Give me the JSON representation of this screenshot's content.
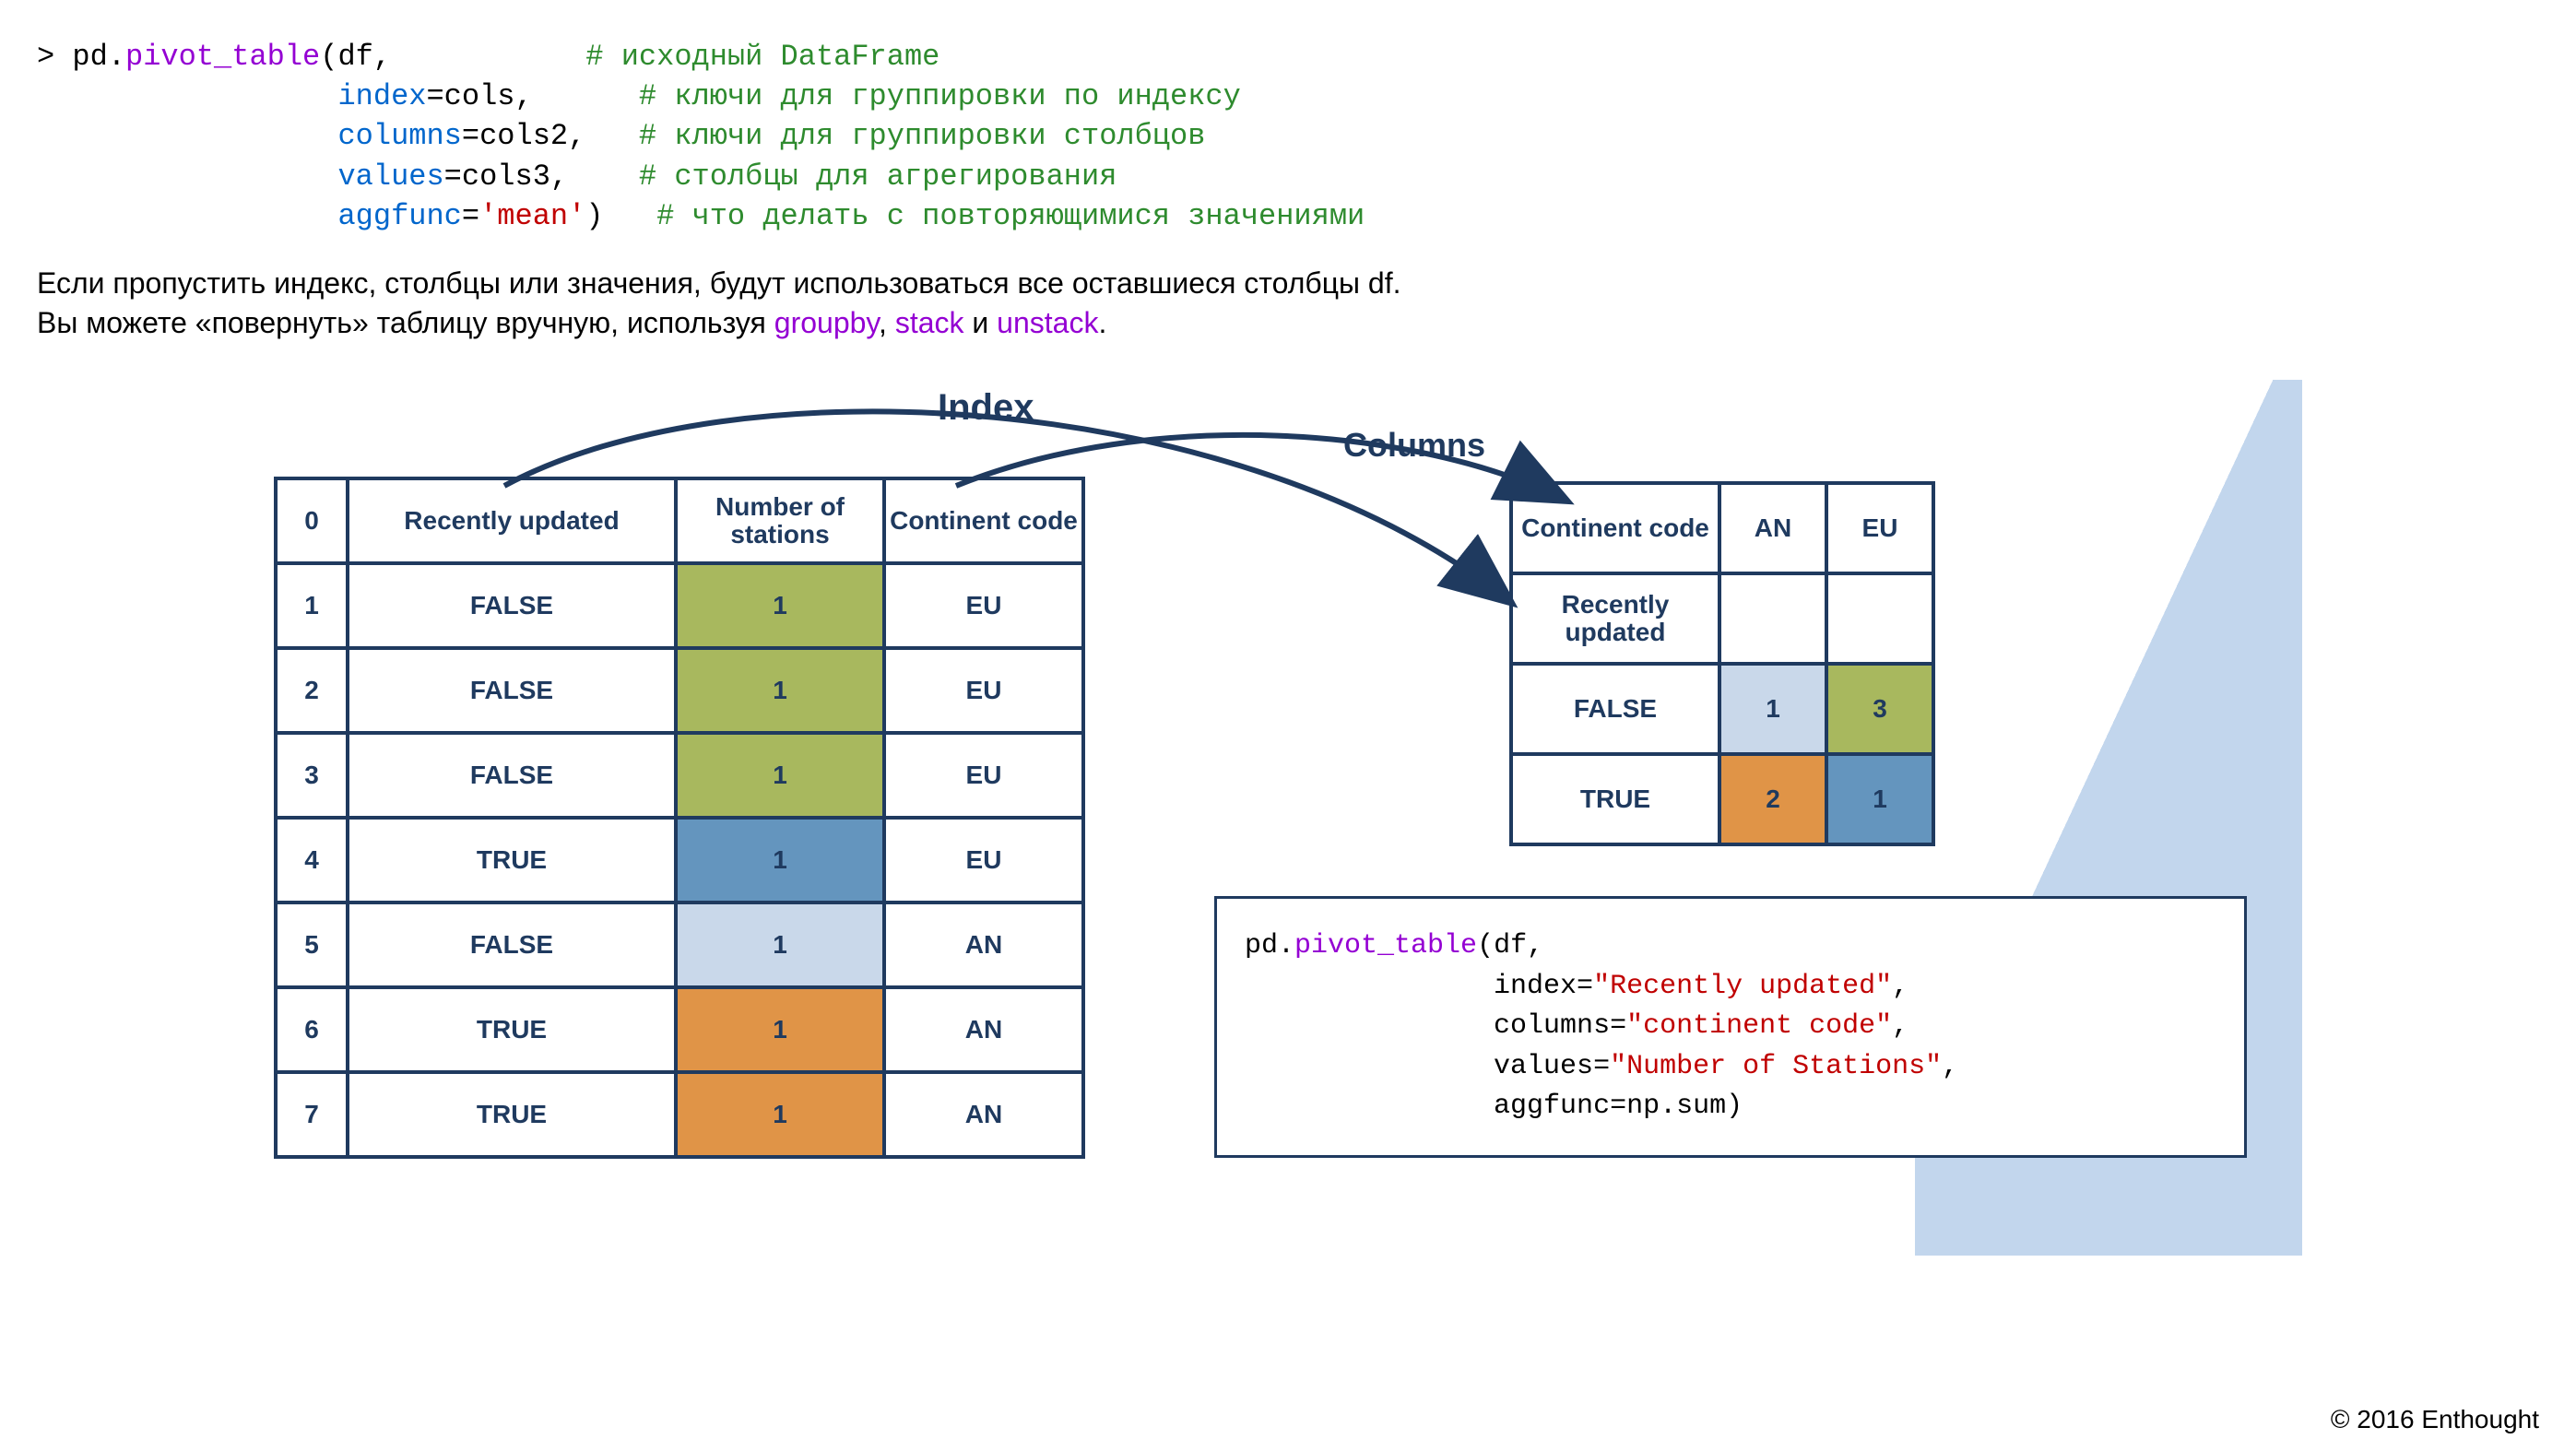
{
  "code_top": {
    "prompt": "> ",
    "call_prefix": "pd.",
    "call_func": "pivot_table",
    "arg_open": "(df,",
    "indent": "                 ",
    "kw_index": "index",
    "eq_index": "=cols,",
    "kw_columns": "columns",
    "eq_columns": "=cols2,",
    "kw_values": "values",
    "eq_values": "=cols3,",
    "kw_aggfunc": "aggfunc",
    "eq_aggfunc": "=",
    "str_mean": "'mean'",
    "close_paren": ")",
    "cmt1": "# исходный DataFrame",
    "cmt2": "# ключи для группировки по индексу",
    "cmt3": "# ключи для группировки столбцов",
    "cmt4": "# столбцы для агрегирования",
    "cmt5": "# что делать с повторяющимися значениями"
  },
  "paragraph": {
    "line1": "Если пропустить индекс, столбцы или значения, будут использоваться все оставшиеся столбцы df.",
    "line2a": "Вы можете «повернуть» таблицу вручную, используя ",
    "link1": "groupby",
    "sep1": ", ",
    "link2": "stack",
    "sep2": " и ",
    "link3": "unstack",
    "dot": "."
  },
  "labels": {
    "index": "Index",
    "columns": "Columns"
  },
  "source_table": {
    "headers": [
      "0",
      "Recently updated",
      "Number of stations",
      "Continent code"
    ],
    "rows": [
      {
        "n": "1",
        "ru": "FALSE",
        "ns": "1",
        "cc": "EU",
        "ns_class": "c-olive"
      },
      {
        "n": "2",
        "ru": "FALSE",
        "ns": "1",
        "cc": "EU",
        "ns_class": "c-olive"
      },
      {
        "n": "3",
        "ru": "FALSE",
        "ns": "1",
        "cc": "EU",
        "ns_class": "c-olive"
      },
      {
        "n": "4",
        "ru": "TRUE",
        "ns": "1",
        "cc": "EU",
        "ns_class": "c-blue-d"
      },
      {
        "n": "5",
        "ru": "FALSE",
        "ns": "1",
        "cc": "AN",
        "ns_class": "c-blue-l"
      },
      {
        "n": "6",
        "ru": "TRUE",
        "ns": "1",
        "cc": "AN",
        "ns_class": "c-orange"
      },
      {
        "n": "7",
        "ru": "TRUE",
        "ns": "1",
        "cc": "AN",
        "ns_class": "c-orange"
      }
    ]
  },
  "result_table": {
    "top_left": "Continent code",
    "col_headers": [
      "AN",
      "EU"
    ],
    "row_header_label": "Recently updated",
    "rows": [
      {
        "label": "FALSE",
        "an": "1",
        "eu": "3",
        "an_class": "c-blue-l",
        "eu_class": "c-olive"
      },
      {
        "label": "TRUE",
        "an": "2",
        "eu": "1",
        "an_class": "c-orange",
        "eu_class": "c-blue-d"
      }
    ]
  },
  "code_box": {
    "l1a": "pd.",
    "l1b": "pivot_table",
    "l1c": "(df,",
    "indent": "               ",
    "l2a": "index=",
    "l2b": "\"Recently updated\"",
    "l2c": ",",
    "l3a": "columns=",
    "l3b": "\"continent code\"",
    "l3c": ",",
    "l4a": "values=",
    "l4b": "\"Number of Stations\"",
    "l4c": ",",
    "l5": "aggfunc=np.sum)"
  },
  "copyright": "© 2016 Enthought"
}
